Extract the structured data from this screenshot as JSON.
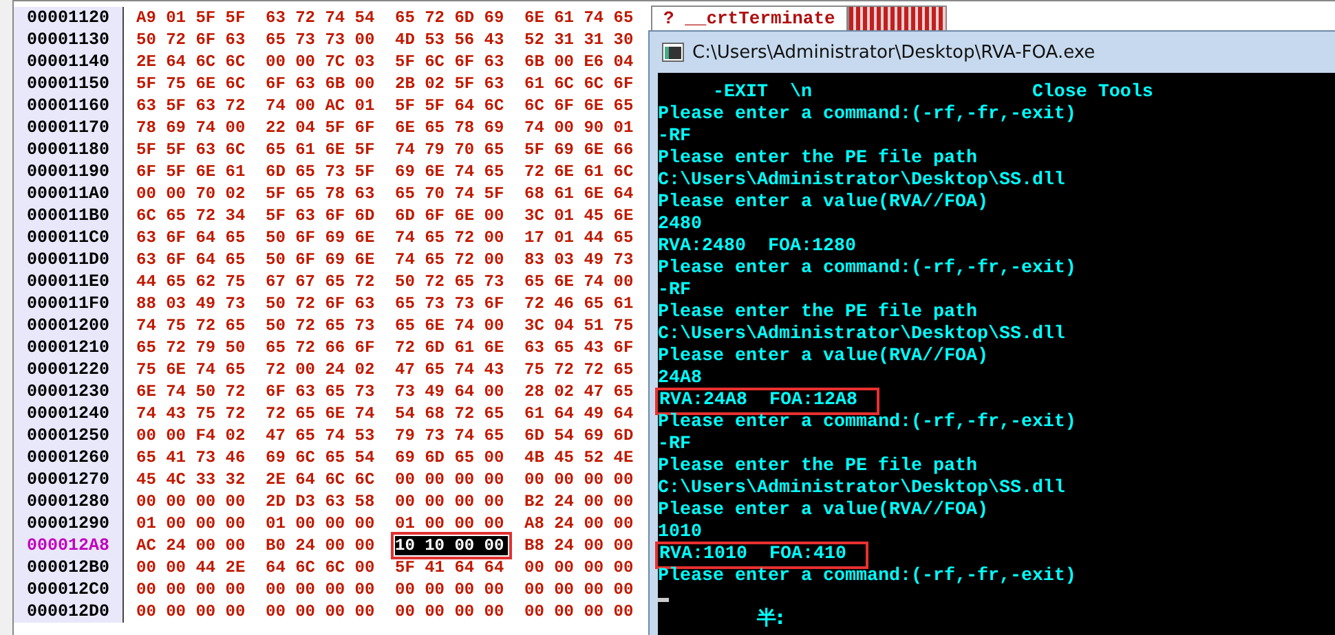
{
  "hex_view": {
    "rows": [
      {
        "address": "00001120",
        "selected": false,
        "groups": [
          {
            "hex": "A9 01 5F 5F",
            "marked": false
          },
          {
            "hex": "63 72 74 54",
            "marked": false
          },
          {
            "hex": "65 72 6D 69",
            "marked": false
          },
          {
            "hex": "6E 61 74 65",
            "marked": false
          }
        ]
      },
      {
        "address": "00001130",
        "selected": false,
        "groups": [
          {
            "hex": "50 72 6F 63",
            "marked": false
          },
          {
            "hex": "65 73 73 00",
            "marked": false
          },
          {
            "hex": "4D 53 56 43",
            "marked": false
          },
          {
            "hex": "52 31 31 30",
            "marked": false
          }
        ]
      },
      {
        "address": "00001140",
        "selected": false,
        "groups": [
          {
            "hex": "2E 64 6C 6C",
            "marked": false
          },
          {
            "hex": "00 00 7C 03",
            "marked": false
          },
          {
            "hex": "5F 6C 6F 63",
            "marked": false
          },
          {
            "hex": "6B 00 E6 04",
            "marked": false
          }
        ]
      },
      {
        "address": "00001150",
        "selected": false,
        "groups": [
          {
            "hex": "5F 75 6E 6C",
            "marked": false
          },
          {
            "hex": "6F 63 6B 00",
            "marked": false
          },
          {
            "hex": "2B 02 5F 63",
            "marked": false
          },
          {
            "hex": "61 6C 6C 6F",
            "marked": false
          }
        ]
      },
      {
        "address": "00001160",
        "selected": false,
        "groups": [
          {
            "hex": "63 5F 63 72",
            "marked": false
          },
          {
            "hex": "74 00 AC 01",
            "marked": false
          },
          {
            "hex": "5F 5F 64 6C",
            "marked": false
          },
          {
            "hex": "6C 6F 6E 65",
            "marked": false
          }
        ]
      },
      {
        "address": "00001170",
        "selected": false,
        "groups": [
          {
            "hex": "78 69 74 00",
            "marked": false
          },
          {
            "hex": "22 04 5F 6F",
            "marked": false
          },
          {
            "hex": "6E 65 78 69",
            "marked": false
          },
          {
            "hex": "74 00 90 01",
            "marked": false
          }
        ]
      },
      {
        "address": "00001180",
        "selected": false,
        "groups": [
          {
            "hex": "5F 5F 63 6C",
            "marked": false
          },
          {
            "hex": "65 61 6E 5F",
            "marked": false
          },
          {
            "hex": "74 79 70 65",
            "marked": false
          },
          {
            "hex": "5F 69 6E 66",
            "marked": false
          }
        ]
      },
      {
        "address": "00001190",
        "selected": false,
        "groups": [
          {
            "hex": "6F 5F 6E 61",
            "marked": false
          },
          {
            "hex": "6D 65 73 5F",
            "marked": false
          },
          {
            "hex": "69 6E 74 65",
            "marked": false
          },
          {
            "hex": "72 6E 61 6C",
            "marked": false
          }
        ]
      },
      {
        "address": "000011A0",
        "selected": false,
        "groups": [
          {
            "hex": "00 00 70 02",
            "marked": false
          },
          {
            "hex": "5F 65 78 63",
            "marked": false
          },
          {
            "hex": "65 70 74 5F",
            "marked": false
          },
          {
            "hex": "68 61 6E 64",
            "marked": false
          }
        ]
      },
      {
        "address": "000011B0",
        "selected": false,
        "groups": [
          {
            "hex": "6C 65 72 34",
            "marked": false
          },
          {
            "hex": "5F 63 6F 6D",
            "marked": false
          },
          {
            "hex": "6D 6F 6E 00",
            "marked": false
          },
          {
            "hex": "3C 01 45 6E",
            "marked": false
          }
        ]
      },
      {
        "address": "000011C0",
        "selected": false,
        "groups": [
          {
            "hex": "63 6F 64 65",
            "marked": false
          },
          {
            "hex": "50 6F 69 6E",
            "marked": false
          },
          {
            "hex": "74 65 72 00",
            "marked": false
          },
          {
            "hex": "17 01 44 65",
            "marked": false
          }
        ]
      },
      {
        "address": "000011D0",
        "selected": false,
        "groups": [
          {
            "hex": "63 6F 64 65",
            "marked": false
          },
          {
            "hex": "50 6F 69 6E",
            "marked": false
          },
          {
            "hex": "74 65 72 00",
            "marked": false
          },
          {
            "hex": "83 03 49 73",
            "marked": false
          }
        ]
      },
      {
        "address": "000011E0",
        "selected": false,
        "groups": [
          {
            "hex": "44 65 62 75",
            "marked": false
          },
          {
            "hex": "67 67 65 72",
            "marked": false
          },
          {
            "hex": "50 72 65 73",
            "marked": false
          },
          {
            "hex": "65 6E 74 00",
            "marked": false
          }
        ]
      },
      {
        "address": "000011F0",
        "selected": false,
        "groups": [
          {
            "hex": "88 03 49 73",
            "marked": false
          },
          {
            "hex": "50 72 6F 63",
            "marked": false
          },
          {
            "hex": "65 73 73 6F",
            "marked": false
          },
          {
            "hex": "72 46 65 61",
            "marked": false
          }
        ]
      },
      {
        "address": "00001200",
        "selected": false,
        "groups": [
          {
            "hex": "74 75 72 65",
            "marked": false
          },
          {
            "hex": "50 72 65 73",
            "marked": false
          },
          {
            "hex": "65 6E 74 00",
            "marked": false
          },
          {
            "hex": "3C 04 51 75",
            "marked": false
          }
        ]
      },
      {
        "address": "00001210",
        "selected": false,
        "groups": [
          {
            "hex": "65 72 79 50",
            "marked": false
          },
          {
            "hex": "65 72 66 6F",
            "marked": false
          },
          {
            "hex": "72 6D 61 6E",
            "marked": false
          },
          {
            "hex": "63 65 43 6F",
            "marked": false
          }
        ]
      },
      {
        "address": "00001220",
        "selected": false,
        "groups": [
          {
            "hex": "75 6E 74 65",
            "marked": false
          },
          {
            "hex": "72 00 24 02",
            "marked": false
          },
          {
            "hex": "47 65 74 43",
            "marked": false
          },
          {
            "hex": "75 72 72 65",
            "marked": false
          }
        ]
      },
      {
        "address": "00001230",
        "selected": false,
        "groups": [
          {
            "hex": "6E 74 50 72",
            "marked": false
          },
          {
            "hex": "6F 63 65 73",
            "marked": false
          },
          {
            "hex": "73 49 64 00",
            "marked": false
          },
          {
            "hex": "28 02 47 65",
            "marked": false
          }
        ]
      },
      {
        "address": "00001240",
        "selected": false,
        "groups": [
          {
            "hex": "74 43 75 72",
            "marked": false
          },
          {
            "hex": "72 65 6E 74",
            "marked": false
          },
          {
            "hex": "54 68 72 65",
            "marked": false
          },
          {
            "hex": "61 64 49 64",
            "marked": false
          }
        ]
      },
      {
        "address": "00001250",
        "selected": false,
        "groups": [
          {
            "hex": "00 00 F4 02",
            "marked": false
          },
          {
            "hex": "47 65 74 53",
            "marked": false
          },
          {
            "hex": "79 73 74 65",
            "marked": false
          },
          {
            "hex": "6D 54 69 6D",
            "marked": false
          }
        ]
      },
      {
        "address": "00001260",
        "selected": false,
        "groups": [
          {
            "hex": "65 41 73 46",
            "marked": false
          },
          {
            "hex": "69 6C 65 54",
            "marked": false
          },
          {
            "hex": "69 6D 65 00",
            "marked": false
          },
          {
            "hex": "4B 45 52 4E",
            "marked": false
          }
        ]
      },
      {
        "address": "00001270",
        "selected": false,
        "groups": [
          {
            "hex": "45 4C 33 32",
            "marked": false
          },
          {
            "hex": "2E 64 6C 6C",
            "marked": false
          },
          {
            "hex": "00 00 00 00",
            "marked": false
          },
          {
            "hex": "00 00 00 00",
            "marked": false
          }
        ]
      },
      {
        "address": "00001280",
        "selected": false,
        "groups": [
          {
            "hex": "00 00 00 00",
            "marked": false
          },
          {
            "hex": "2D D3 63 58",
            "marked": false
          },
          {
            "hex": "00 00 00 00",
            "marked": false
          },
          {
            "hex": "B2 24 00 00",
            "marked": false
          }
        ]
      },
      {
        "address": "00001290",
        "selected": false,
        "groups": [
          {
            "hex": "01 00 00 00",
            "marked": false
          },
          {
            "hex": "01 00 00 00",
            "marked": false
          },
          {
            "hex": "01 00 00 00",
            "marked": false
          },
          {
            "hex": "A8 24 00 00",
            "marked": false
          }
        ]
      },
      {
        "address": "000012A8",
        "selected": true,
        "groups": [
          {
            "hex": "AC 24 00 00",
            "marked": false
          },
          {
            "hex": "B0 24 00 00",
            "marked": false
          },
          {
            "hex": "10 10 00 00",
            "marked": true
          },
          {
            "hex": "B8 24 00 00",
            "marked": false
          }
        ]
      },
      {
        "address": "000012B0",
        "selected": false,
        "groups": [
          {
            "hex": "00 00 44 2E",
            "marked": false
          },
          {
            "hex": "64 6C 6C 00",
            "marked": false
          },
          {
            "hex": "5F 41 64 64",
            "marked": false
          },
          {
            "hex": "00 00 00 00",
            "marked": false
          }
        ]
      },
      {
        "address": "000012C0",
        "selected": false,
        "groups": [
          {
            "hex": "00 00 00 00",
            "marked": false
          },
          {
            "hex": "00 00 00 00",
            "marked": false
          },
          {
            "hex": "00 00 00 00",
            "marked": false
          },
          {
            "hex": "00 00 00 00",
            "marked": false
          }
        ]
      },
      {
        "address": "000012D0",
        "selected": false,
        "groups": [
          {
            "hex": "00 00 00 00",
            "marked": false
          },
          {
            "hex": "00 00 00 00",
            "marked": false
          },
          {
            "hex": "00 00 00 00",
            "marked": false
          },
          {
            "hex": "00 00 00 00",
            "marked": false
          }
        ]
      }
    ]
  },
  "symbol_cell": "? __crtTerminate",
  "console": {
    "title": "C:\\Users\\Administrator\\Desktop\\RVA-FOA.exe",
    "lines": [
      {
        "text": "     -EXIT  \\n                    Close Tools",
        "highlighted": false
      },
      {
        "text": "Please enter a command:(-rf,-fr,-exit)",
        "highlighted": false
      },
      {
        "text": "-RF",
        "highlighted": false
      },
      {
        "text": "Please enter the PE file path",
        "highlighted": false
      },
      {
        "text": "C:\\Users\\Administrator\\Desktop\\SS.dll",
        "highlighted": false
      },
      {
        "text": "Please enter a value(RVA//FOA)",
        "highlighted": false
      },
      {
        "text": "2480",
        "highlighted": false
      },
      {
        "text": "RVA:2480  FOA:1280",
        "highlighted": false
      },
      {
        "text": "Please enter a command:(-rf,-fr,-exit)",
        "highlighted": false
      },
      {
        "text": "-RF",
        "highlighted": false
      },
      {
        "text": "Please enter the PE file path",
        "highlighted": false
      },
      {
        "text": "C:\\Users\\Administrator\\Desktop\\SS.dll",
        "highlighted": false
      },
      {
        "text": "Please enter a value(RVA//FOA)",
        "highlighted": false
      },
      {
        "text": "24A8",
        "highlighted": false
      },
      {
        "text": "RVA:24A8  FOA:12A8",
        "highlighted": true
      },
      {
        "text": "Please enter a command:(-rf,-fr,-exit)",
        "highlighted": false
      },
      {
        "text": "-RF",
        "highlighted": false
      },
      {
        "text": "Please enter the PE file path",
        "highlighted": false
      },
      {
        "text": "C:\\Users\\Administrator\\Desktop\\SS.dll",
        "highlighted": false
      },
      {
        "text": "Please enter a value(RVA//FOA)",
        "highlighted": false
      },
      {
        "text": "1010",
        "highlighted": false
      },
      {
        "text": "RVA:1010  FOA:410",
        "highlighted": true
      },
      {
        "text": "Please enter a command:(-rf,-fr,-exit)",
        "highlighted": false
      }
    ],
    "ime_indicator": "半:"
  }
}
